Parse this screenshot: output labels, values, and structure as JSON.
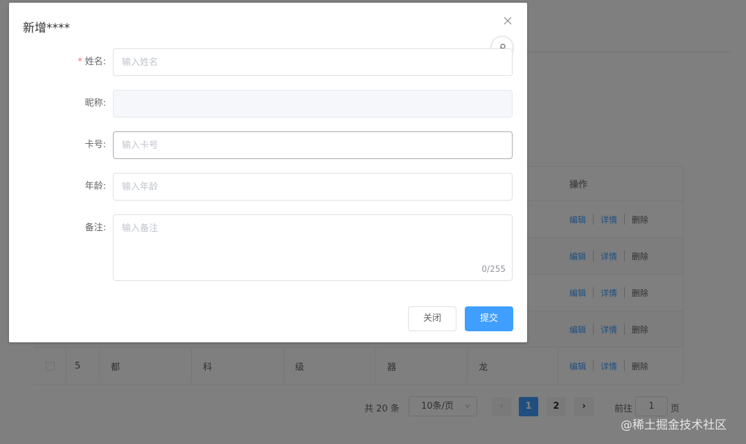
{
  "dialog": {
    "title": "新增****",
    "close_glyph": "×",
    "fields": {
      "name": {
        "required_mark": "*",
        "label": "姓名:",
        "placeholder": "输入姓名",
        "value": ""
      },
      "nickname": {
        "label": "昵称:",
        "value": ""
      },
      "card": {
        "label": "卡号:",
        "placeholder": "输入卡号",
        "value": ""
      },
      "age": {
        "label": "年龄:",
        "placeholder": "输入年龄",
        "value": ""
      },
      "note": {
        "label": "备注:",
        "placeholder": "输入备注",
        "value": "",
        "counter": "0/255"
      }
    },
    "buttons": {
      "close": "关闭",
      "submit": "提交"
    }
  },
  "table": {
    "op_header": "操作",
    "edit": "编辑",
    "detail": "详情",
    "delete": "删除",
    "last_row": {
      "index": "5",
      "c1": "都",
      "c2": "科",
      "c3": "级",
      "c4": "器",
      "c5": "龙"
    }
  },
  "pagination": {
    "total": "共 20 条",
    "page_size": "10条/页",
    "prev": "‹",
    "next": "›",
    "pages": [
      "1",
      "2"
    ],
    "current": "1",
    "goto_label": "前往",
    "goto_value": "1",
    "page_unit": "页"
  },
  "watermark": "@稀土掘金技术社区",
  "colors": {
    "primary": "#409eff",
    "required": "#f56c6c",
    "mask": "rgba(0,0,0,0.5)"
  },
  "icons": {
    "close": "close-icon",
    "fab": "search-icon",
    "size_arrow": "chevron-down-icon"
  }
}
